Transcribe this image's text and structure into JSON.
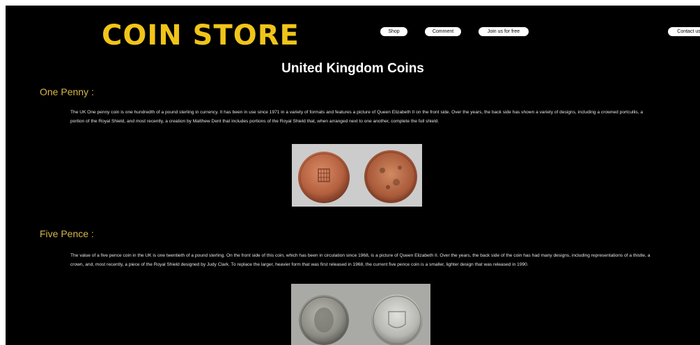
{
  "header": {
    "logo": "COIN STORE",
    "nav": [
      "Shop",
      "Comment",
      "Join us for free",
      "Contact us"
    ]
  },
  "main": {
    "title": "United Kingdom Coins",
    "sections": [
      {
        "heading": "One Penny :",
        "text": "The UK One penny coin is one hundredth of a pound sterling in currency. It has been in use since 1971 in a variety of formats and features a picture of Queen Elizabeth II on the front side. Over the years, the back side has shown a variety of designs, including a crowned portcullis, a portion of the Royal Shield, and most recently, a creation by Matthew Dent that includes portions of the Royal Shield that, when arranged next to one another, complete the full shield."
      },
      {
        "heading": "Five Pence :",
        "text": "The value of a five pence coin in the UK is one twentieth of a pound sterling. On the front side of this coin, which has been in circulation since 1968, is a picture of Queen Elizabeth II. Over the years, the back side of the coin has had many designs, including representations of a thistle, a crown, and, most recently, a piece of the Royal Shield designed by Judy Clark. To replace the larger, heavier form that was first released in 1968, the current five pence coin is a smaller, lighter design that was released in 1990."
      }
    ]
  },
  "colors": {
    "background": "#000000",
    "logo": "#f0c419",
    "heading": "#d8b64a",
    "text": "#e6e6e6"
  }
}
